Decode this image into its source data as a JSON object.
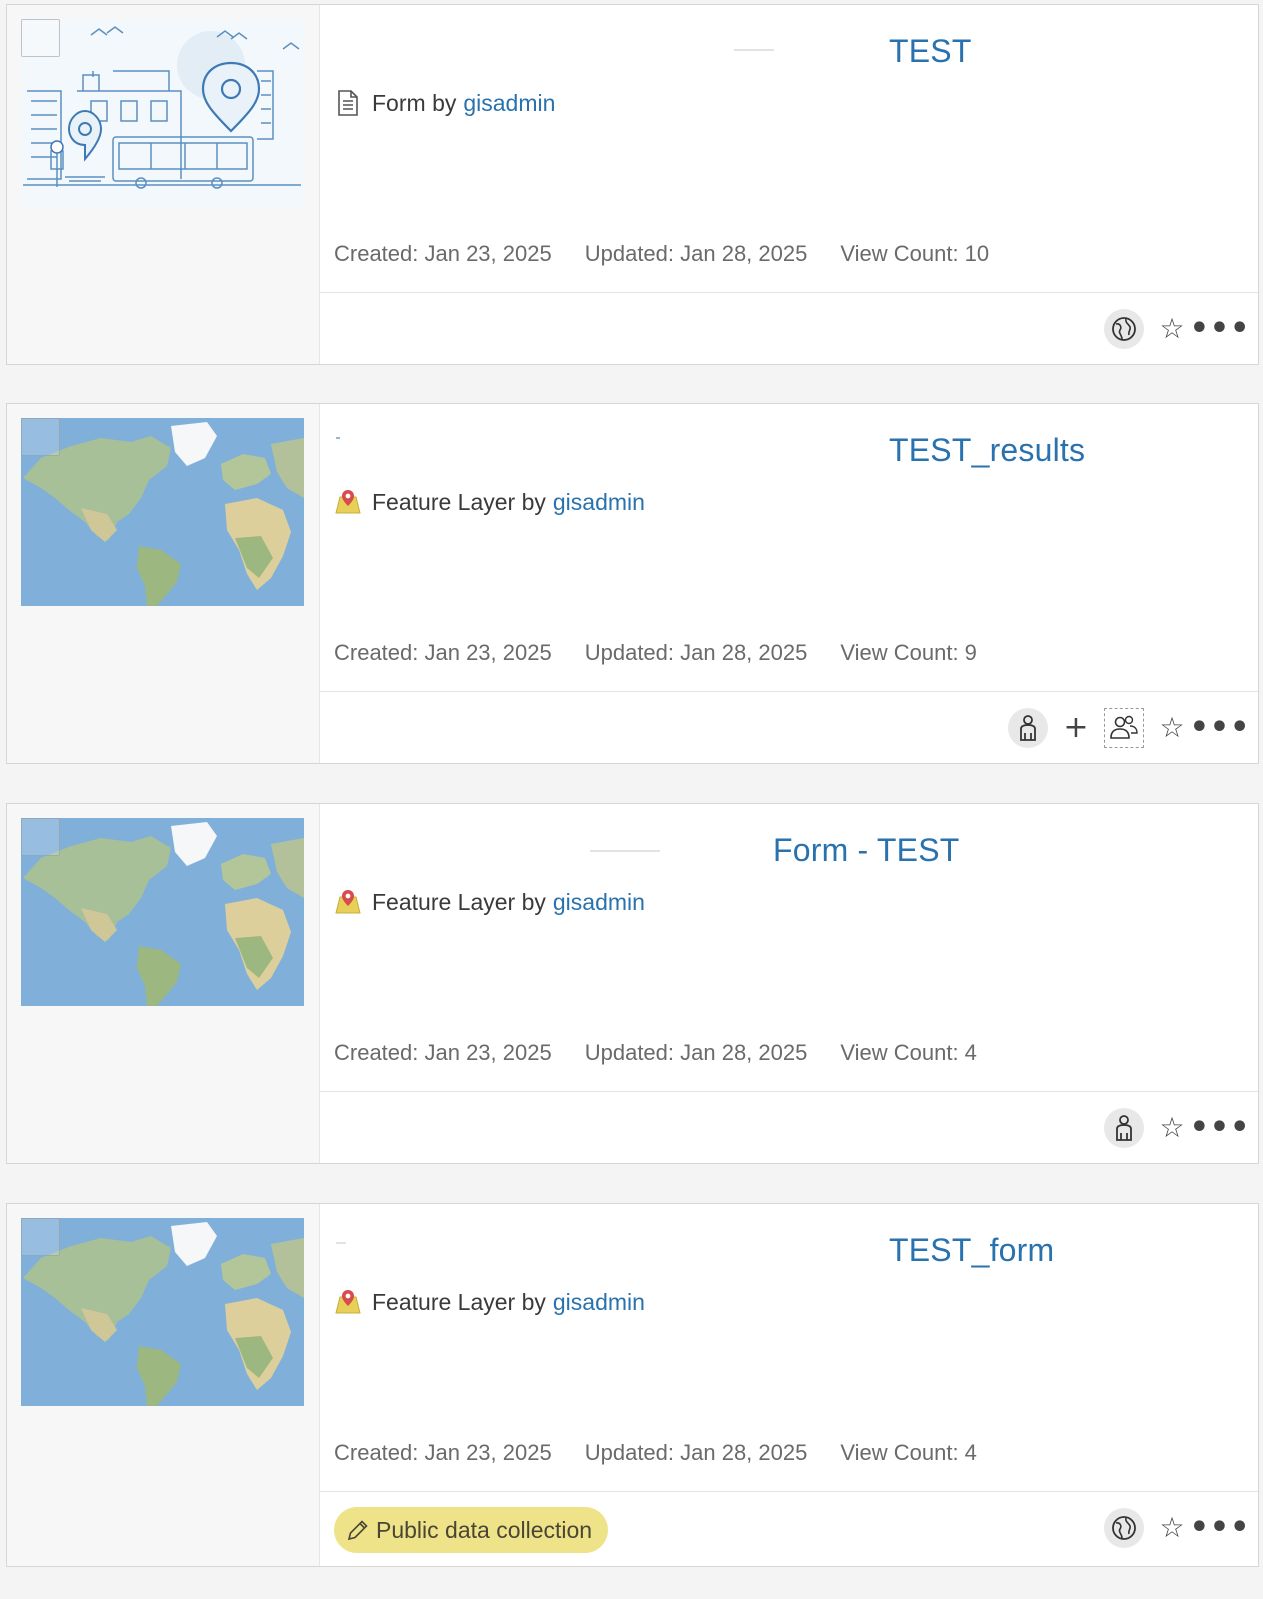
{
  "items": [
    {
      "title": "TEST",
      "type": "Form",
      "by": "by",
      "owner": "gisadmin",
      "created": "Created: Jan 23, 2025",
      "updated": "Updated: Jan 28, 2025",
      "views": "View Count: 10",
      "type_icon": "form-document-icon",
      "sharing_icon": "globe-icon"
    },
    {
      "title": "TEST_results",
      "type": "Feature Layer",
      "by": "by",
      "owner": "gisadmin",
      "created": "Created: Jan 23, 2025",
      "updated": "Updated: Jan 28, 2025",
      "views": "View Count: 9",
      "type_icon": "feature-layer-icon",
      "sharing_icon": "person-icon"
    },
    {
      "title": "Form - TEST",
      "type": "Feature Layer",
      "by": "by",
      "owner": "gisadmin",
      "created": "Created: Jan 23, 2025",
      "updated": "Updated: Jan 28, 2025",
      "views": "View Count: 4",
      "type_icon": "feature-layer-icon",
      "sharing_icon": "person-icon"
    },
    {
      "title": "TEST_form",
      "type": "Feature Layer",
      "by": "by",
      "owner": "gisadmin",
      "created": "Created: Jan 23, 2025",
      "updated": "Updated: Jan 28, 2025",
      "views": "View Count: 4",
      "type_icon": "feature-layer-icon",
      "sharing_icon": "globe-icon",
      "badge": "Public data collection"
    }
  ],
  "actions": {
    "plus": "+",
    "star": "☆",
    "more": "•••"
  },
  "colors": {
    "link": "#2a72ae",
    "badge": "#efe38a",
    "card_border": "#d6d6d6"
  }
}
